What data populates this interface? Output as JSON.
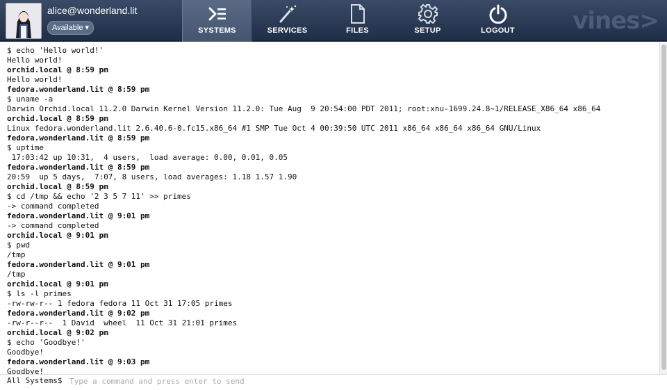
{
  "user": {
    "email": "alice@wonderland.lit",
    "status": "Available",
    "status_caret": "▾"
  },
  "nav": [
    {
      "label": "SYSTEMS",
      "icon": "terminal-icon",
      "active": true
    },
    {
      "label": "SERVICES",
      "icon": "wand-icon",
      "active": false
    },
    {
      "label": "FILES",
      "icon": "file-icon",
      "active": false
    },
    {
      "label": "SETUP",
      "icon": "gear-icon",
      "active": false
    },
    {
      "label": "LOGOUT",
      "icon": "power-icon",
      "active": false
    }
  ],
  "logo": "vines>",
  "terminal": [
    {
      "text": "$ echo 'Hello world!'",
      "kind": "cmd"
    },
    {
      "text": "Hello world!",
      "kind": "out"
    },
    {
      "text": "orchid.local @ 8:59 pm",
      "kind": "prompt"
    },
    {
      "text": "Hello world!",
      "kind": "out"
    },
    {
      "text": "fedora.wonderland.lit @ 8:59 pm",
      "kind": "prompt"
    },
    {
      "text": "$ uname -a",
      "kind": "cmd"
    },
    {
      "text": "Darwin Orchid.local 11.2.0 Darwin Kernel Version 11.2.0: Tue Aug  9 20:54:00 PDT 2011; root:xnu-1699.24.8~1/RELEASE_X86_64 x86_64",
      "kind": "out"
    },
    {
      "text": "orchid.local @ 8:59 pm",
      "kind": "prompt"
    },
    {
      "text": "Linux fedora.wonderland.lit 2.6.40.6-0.fc15.x86_64 #1 SMP Tue Oct 4 00:39:50 UTC 2011 x86_64 x86_64 x86_64 GNU/Linux",
      "kind": "out"
    },
    {
      "text": "fedora.wonderland.lit @ 8:59 pm",
      "kind": "prompt"
    },
    {
      "text": "$ uptime",
      "kind": "cmd"
    },
    {
      "text": " 17:03:42 up 10:31,  4 users,  load average: 0.00, 0.01, 0.05",
      "kind": "out"
    },
    {
      "text": "fedora.wonderland.lit @ 8:59 pm",
      "kind": "prompt"
    },
    {
      "text": "20:59  up 5 days,  7:07, 8 users, load averages: 1.18 1.57 1.90",
      "kind": "out"
    },
    {
      "text": "orchid.local @ 8:59 pm",
      "kind": "prompt"
    },
    {
      "text": "$ cd /tmp && echo '2 3 5 7 11' >> primes",
      "kind": "cmd"
    },
    {
      "text": "-> command completed",
      "kind": "out"
    },
    {
      "text": "fedora.wonderland.lit @ 9:01 pm",
      "kind": "prompt"
    },
    {
      "text": "-> command completed",
      "kind": "out"
    },
    {
      "text": "orchid.local @ 9:01 pm",
      "kind": "prompt"
    },
    {
      "text": "$ pwd",
      "kind": "cmd"
    },
    {
      "text": "/tmp",
      "kind": "out"
    },
    {
      "text": "fedora.wonderland.lit @ 9:01 pm",
      "kind": "prompt"
    },
    {
      "text": "/tmp",
      "kind": "out"
    },
    {
      "text": "orchid.local @ 9:01 pm",
      "kind": "prompt"
    },
    {
      "text": "$ ls -l primes",
      "kind": "cmd"
    },
    {
      "text": "-rw-rw-r-- 1 fedora fedora 11 Oct 31 17:05 primes",
      "kind": "out"
    },
    {
      "text": "fedora.wonderland.lit @ 9:02 pm",
      "kind": "prompt"
    },
    {
      "text": "-rw-r--r--  1 David  wheel  11 Oct 31 21:01 primes",
      "kind": "out"
    },
    {
      "text": "orchid.local @ 9:02 pm",
      "kind": "prompt"
    },
    {
      "text": "$ echo 'Goodbye!'",
      "kind": "cmd"
    },
    {
      "text": "Goodbye!",
      "kind": "out"
    },
    {
      "text": "fedora.wonderland.lit @ 9:03 pm",
      "kind": "prompt"
    },
    {
      "text": "Goodbye!",
      "kind": "out"
    }
  ],
  "command": {
    "label": "All Systems$",
    "placeholder": "Type a command and press enter to send",
    "value": ""
  }
}
